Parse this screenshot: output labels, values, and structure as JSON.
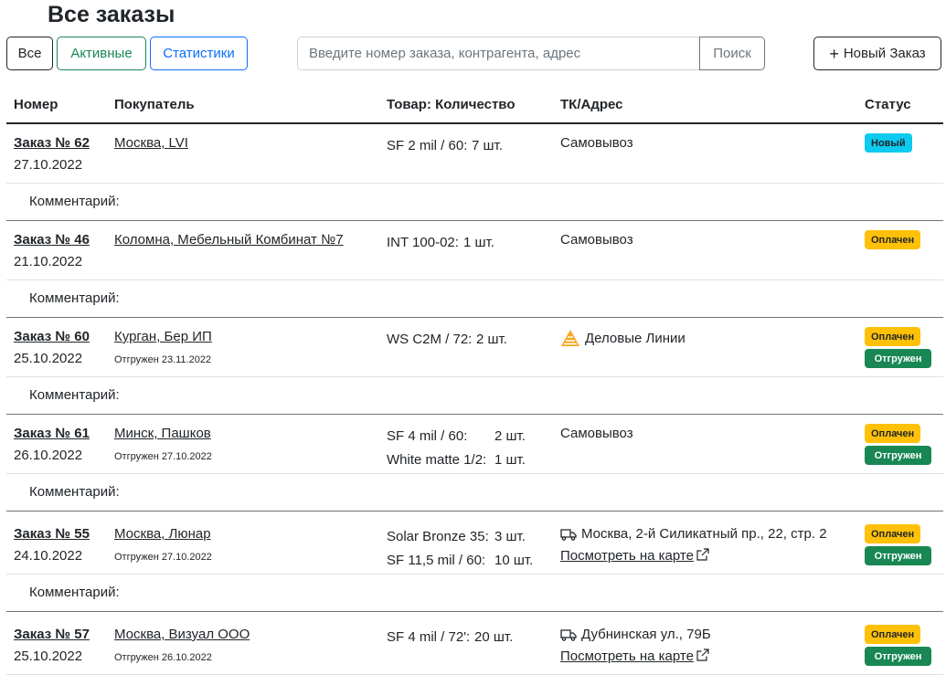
{
  "page_title": "Все заказы",
  "toolbar": {
    "all_label": "Все",
    "active_label": "Активные",
    "stats_label": "Статистики",
    "search_placeholder": "Введите номер заказа, контрагента, адрес",
    "search_button": "Поиск",
    "new_order_label": "Новый Заказ",
    "new_order_icon": "plus-icon"
  },
  "columns": {
    "number": "Номер",
    "buyer": "Покупатель",
    "goods": "Товар: Количество",
    "tk": "ТК/Адрес",
    "status": "Статус"
  },
  "colors": {
    "info": "#0dcaf0",
    "warning": "#ffc107",
    "success": "#198754",
    "primary": "#0d6efd"
  },
  "orders": [
    {
      "number": "Заказ № 62",
      "date": "27.10.2022",
      "buyer": "Москва, LVI",
      "shipped": "",
      "items": [
        {
          "name": "SF 2 mil / 60:",
          "qty": "7 шт."
        }
      ],
      "tk": "Самовывоз",
      "map": "",
      "badges": [
        "Новый"
      ],
      "comment": "Комментарий:"
    },
    {
      "number": "Заказ № 46",
      "date": "21.10.2022",
      "buyer": "Коломна, Мебельный Комбинат №7",
      "shipped": "",
      "items": [
        {
          "name": "INT 100-02:",
          "qty": "1 шт."
        }
      ],
      "tk": "Самовывоз",
      "map": "",
      "badges": [
        "Оплачен"
      ],
      "comment": "Комментарий:"
    },
    {
      "number": "Заказ № 60",
      "date": "25.10.2022",
      "buyer": "Курган, Бер ИП",
      "shipped": "Отгружен 23.11.2022",
      "items": [
        {
          "name": "WS C2M / 72:",
          "qty": "2 шт."
        }
      ],
      "tk": "Деловые Линии",
      "tk_icon": "delovye-linii-logo-icon",
      "map": "",
      "badges": [
        "Оплачен",
        "Отгружен"
      ],
      "comment": "Комментарий:"
    },
    {
      "number": "Заказ № 61",
      "date": "26.10.2022",
      "buyer": "Минск, Пашков",
      "shipped": "Отгружен 27.10.2022",
      "items": [
        {
          "name": "SF 4 mil / 60:",
          "qty": "2 шт."
        },
        {
          "name": "White matte 1/2:",
          "qty": "1 шт."
        }
      ],
      "tk": "Самовывоз",
      "map": "",
      "badges": [
        "Оплачен",
        "Отгружен"
      ],
      "comment": "Комментарий:"
    },
    {
      "number": "Заказ № 55",
      "date": "24.10.2022",
      "buyer": "Москва, Люнар",
      "shipped": "Отгружен 27.10.2022",
      "items": [
        {
          "name": "Solar Bronze 35:",
          "qty": "3 шт."
        },
        {
          "name": "SF 11,5 mil / 60:",
          "qty": "10 шт."
        }
      ],
      "tk": "Москва, 2-й Силикатный пр., 22, стр. 2",
      "tk_icon": "truck-icon",
      "map": "Посмотреть на карте",
      "badges": [
        "Оплачен",
        "Отгружен"
      ],
      "comment": "Комментарий:"
    },
    {
      "number": "Заказ № 57",
      "date": "25.10.2022",
      "buyer": "Москва, Визуал ООО",
      "shipped": "Отгружен 26.10.2022",
      "items": [
        {
          "name": "SF 4 mil / 72':",
          "qty": "20 шт."
        }
      ],
      "tk": "Дубнинская ул., 79Б",
      "tk_icon": "truck-icon",
      "map": "Посмотреть на карте",
      "badges": [
        "Оплачен",
        "Отгружен"
      ],
      "comment": ""
    }
  ]
}
